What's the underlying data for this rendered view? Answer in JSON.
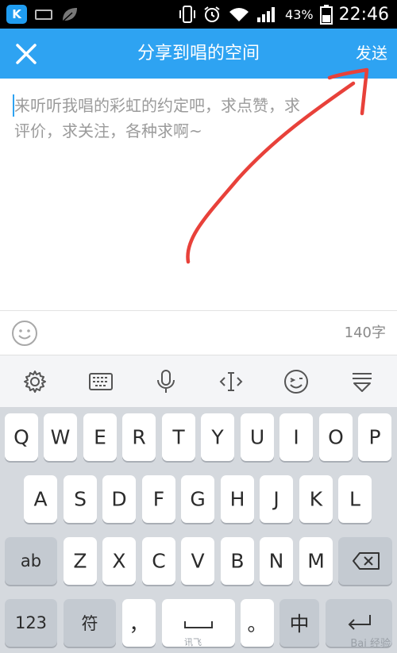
{
  "status_bar": {
    "app_badge": "K",
    "battery_percent": "43%",
    "time": "22:46"
  },
  "header": {
    "title": "分享到唱的空间",
    "send_label": "发送",
    "close_icon": "close-icon"
  },
  "compose": {
    "placeholder_line1": "来听听我唱的彩虹的约定吧，求点赞，求",
    "placeholder_line2": "评价，求关注，各种求啊~",
    "annotation_color": "#e8413a"
  },
  "footer": {
    "counter": "140字"
  },
  "keyboard": {
    "row1": [
      "Q",
      "W",
      "E",
      "R",
      "T",
      "Y",
      "U",
      "I",
      "O",
      "P"
    ],
    "row2": [
      "A",
      "S",
      "D",
      "F",
      "G",
      "H",
      "J",
      "K",
      "L"
    ],
    "row3_mode": "ab",
    "row3": [
      "Z",
      "X",
      "C",
      "V",
      "B",
      "N",
      "M"
    ],
    "row4_num": "123",
    "row4_sym": "符",
    "row4_comma": "，",
    "row4_period": "。",
    "row4_lang": "中",
    "ifly_label": "讯飞",
    "watermark": "Bai 经验"
  },
  "colors": {
    "accent": "#2ea3f2",
    "keyboard_bg": "#d5d9de",
    "placeholder": "#9b9b9b"
  }
}
